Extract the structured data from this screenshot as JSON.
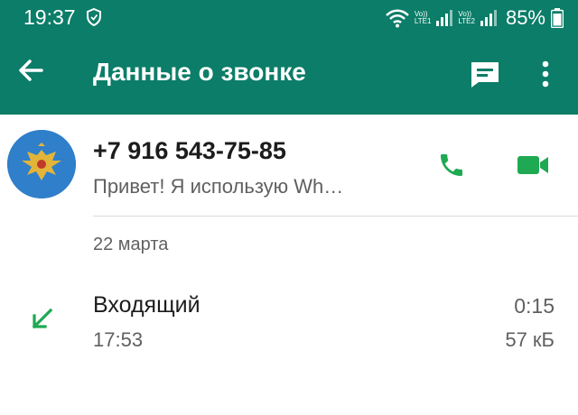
{
  "status_bar": {
    "time": "19:37",
    "sim1_label_top": "Vo))",
    "sim1_label_bottom": "LTE1",
    "sim2_label_top": "Vo))",
    "sim2_label_bottom": "LTE2",
    "battery": "85%"
  },
  "toolbar": {
    "title": "Данные о звонке",
    "back_icon": "arrow-back-icon",
    "message_icon": "message-icon",
    "more_icon": "more-vert-icon"
  },
  "contact": {
    "phone": "+7 916 543-75-85",
    "status": "Привет! Я использую Wh…",
    "avatar_icon": "eagle-emblem-icon",
    "call_icon": "phone-icon",
    "video_icon": "video-icon"
  },
  "call_log": {
    "date": "22 марта",
    "entries": [
      {
        "type": "Входящий",
        "time": "17:53",
        "duration": "0:15",
        "size": "57 кБ",
        "direction_icon": "incoming-arrow-icon"
      }
    ]
  },
  "colors": {
    "header": "#0b7d68",
    "accent": "#1ea952",
    "text_primary": "#1c1c1c",
    "text_secondary": "#606060"
  }
}
